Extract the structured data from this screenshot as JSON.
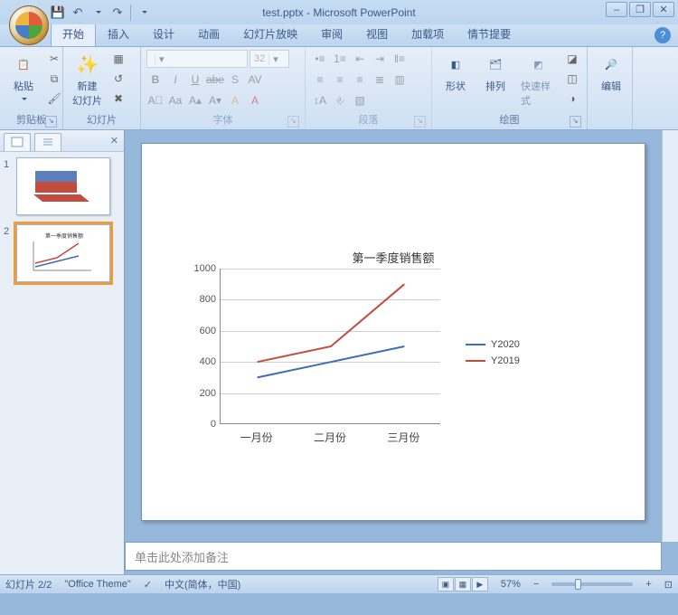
{
  "title": "test.pptx - Microsoft PowerPoint",
  "tabs": [
    "开始",
    "插入",
    "设计",
    "动画",
    "幻灯片放映",
    "审阅",
    "视图",
    "加载项",
    "情节提要"
  ],
  "active_tab": 0,
  "ribbon": {
    "clipboard": {
      "label": "剪贴板",
      "paste": "粘贴"
    },
    "slides": {
      "label": "幻灯片",
      "new_slide": "新建\n幻灯片"
    },
    "font": {
      "label": "字体",
      "font_name": "",
      "font_size": "32"
    },
    "paragraph": {
      "label": "段落"
    },
    "drawing": {
      "label": "绘图",
      "shapes": "形状",
      "arrange": "排列",
      "quick_styles": "快速样式"
    },
    "editing": {
      "label": "编辑"
    }
  },
  "thumbs": [
    "1",
    "2"
  ],
  "selected_thumb": 1,
  "notes_placeholder": "单击此处添加备注",
  "status": {
    "slide_counter": "幻灯片 2/2",
    "theme": "\"Office Theme\"",
    "language": "中文(简体，中国)",
    "zoom": "57%"
  },
  "chart_data": {
    "type": "line",
    "title": "第一季度销售额",
    "categories": [
      "一月份",
      "二月份",
      "三月份"
    ],
    "series": [
      {
        "name": "Y2020",
        "color": "#3c6fb1",
        "values": [
          300,
          400,
          500
        ]
      },
      {
        "name": "Y2019",
        "color": "#c24c3e",
        "values": [
          400,
          500,
          900
        ]
      }
    ],
    "ylim": [
      0,
      1000
    ],
    "yticks": [
      0,
      200,
      400,
      600,
      800,
      1000
    ]
  }
}
